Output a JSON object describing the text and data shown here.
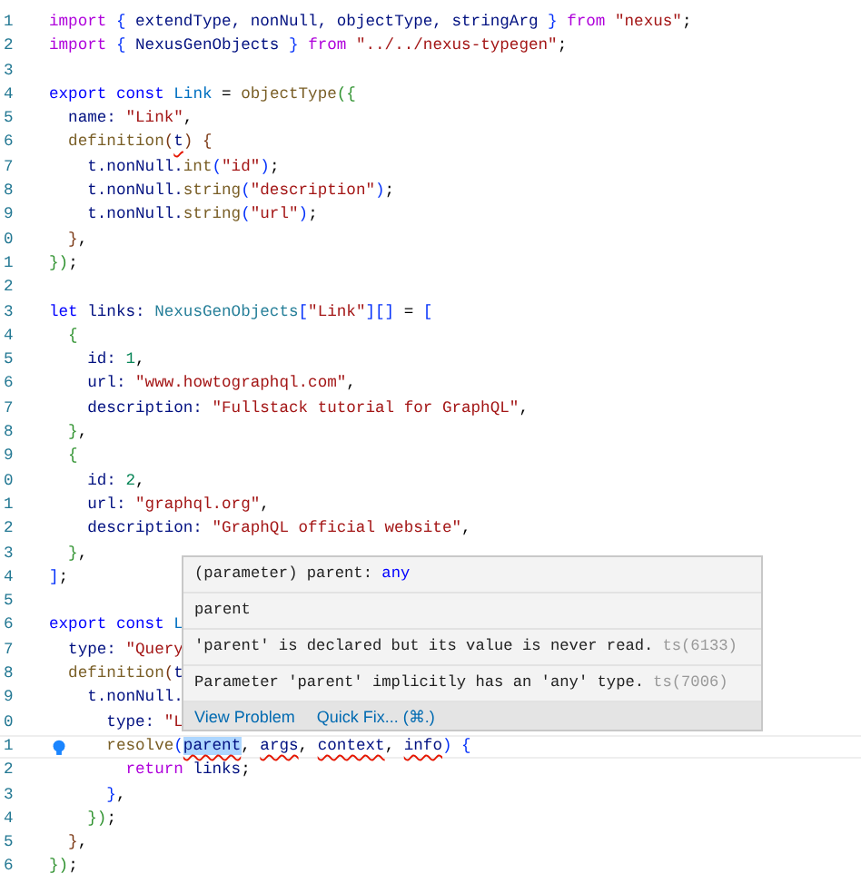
{
  "editor": {
    "lines": [
      {
        "number": "1",
        "current": false,
        "tokens": [
          {
            "text": "import",
            "kind": "control"
          },
          {
            "text": " { ",
            "kind": "b1"
          },
          {
            "text": "extendType, nonNull, objectType, stringArg",
            "kind": "var"
          },
          {
            "text": " } ",
            "kind": "b1"
          },
          {
            "text": "from",
            "kind": "control"
          },
          {
            "text": " \"nexus\"",
            "kind": "str"
          },
          {
            "text": ";",
            "kind": "plain"
          }
        ]
      },
      {
        "number": "2",
        "current": false,
        "tokens": [
          {
            "text": "import",
            "kind": "control"
          },
          {
            "text": " { ",
            "kind": "b1"
          },
          {
            "text": "NexusGenObjects",
            "kind": "var"
          },
          {
            "text": " } ",
            "kind": "b1"
          },
          {
            "text": "from",
            "kind": "control"
          },
          {
            "text": " \"../../nexus-typegen\"",
            "kind": "str"
          },
          {
            "text": ";",
            "kind": "plain"
          }
        ]
      },
      {
        "number": "3",
        "current": false
      },
      {
        "number": "4",
        "current": false,
        "tokens": [
          {
            "text": "export const",
            "kind": "storage"
          },
          {
            "text": " Link",
            "kind": "const"
          },
          {
            "text": " = ",
            "kind": "plain"
          },
          {
            "text": "objectType",
            "kind": "func"
          },
          {
            "text": "({",
            "kind": "b2"
          }
        ]
      },
      {
        "number": "5",
        "current": false,
        "tokens": [
          {
            "text": "  name: ",
            "kind": "var"
          },
          {
            "text": "\"Link\"",
            "kind": "str"
          },
          {
            "text": ",",
            "kind": "plain"
          }
        ]
      },
      {
        "number": "6",
        "current": false,
        "tokens": [
          {
            "text": "  definition",
            "kind": "func"
          },
          {
            "text": "(",
            "kind": "b3"
          },
          {
            "text": "t",
            "kind": "var-error"
          },
          {
            "text": ") {",
            "kind": "b3"
          }
        ]
      },
      {
        "number": "7",
        "current": false,
        "tokens": [
          {
            "text": "    t.nonNull.",
            "kind": "var"
          },
          {
            "text": "int",
            "kind": "func"
          },
          {
            "text": "(",
            "kind": "b1"
          },
          {
            "text": "\"id\"",
            "kind": "str"
          },
          {
            "text": ")",
            "kind": "b1"
          },
          {
            "text": ";",
            "kind": "plain"
          }
        ]
      },
      {
        "number": "8",
        "current": false,
        "tokens": [
          {
            "text": "    t.nonNull.",
            "kind": "var"
          },
          {
            "text": "string",
            "kind": "func"
          },
          {
            "text": "(",
            "kind": "b1"
          },
          {
            "text": "\"description\"",
            "kind": "str"
          },
          {
            "text": ")",
            "kind": "b1"
          },
          {
            "text": ";",
            "kind": "plain"
          }
        ]
      },
      {
        "number": "9",
        "current": false,
        "tokens": [
          {
            "text": "    t.nonNull.",
            "kind": "var"
          },
          {
            "text": "string",
            "kind": "func"
          },
          {
            "text": "(",
            "kind": "b1"
          },
          {
            "text": "\"url\"",
            "kind": "str"
          },
          {
            "text": ")",
            "kind": "b1"
          },
          {
            "text": ";",
            "kind": "plain"
          }
        ]
      },
      {
        "number": "0",
        "current": false,
        "tokens": [
          {
            "text": "  }",
            "kind": "b3"
          },
          {
            "text": ",",
            "kind": "plain"
          }
        ]
      },
      {
        "number": "1",
        "current": false,
        "tokens": [
          {
            "text": "})",
            "kind": "b2"
          },
          {
            "text": ";",
            "kind": "plain"
          }
        ]
      },
      {
        "number": "2",
        "current": false
      },
      {
        "number": "3",
        "current": false,
        "tokens": [
          {
            "text": "let",
            "kind": "storage"
          },
          {
            "text": " links: ",
            "kind": "var"
          },
          {
            "text": "NexusGenObjects",
            "kind": "type"
          },
          {
            "text": "[",
            "kind": "b1"
          },
          {
            "text": "\"Link\"",
            "kind": "str"
          },
          {
            "text": "][]",
            "kind": "b1"
          },
          {
            "text": " = ",
            "kind": "plain"
          },
          {
            "text": "[",
            "kind": "b1"
          }
        ]
      },
      {
        "number": "4",
        "current": false,
        "tokens": [
          {
            "text": "  {",
            "kind": "b2"
          }
        ]
      },
      {
        "number": "5",
        "current": false,
        "tokens": [
          {
            "text": "    id: ",
            "kind": "var"
          },
          {
            "text": "1",
            "kind": "num"
          },
          {
            "text": ",",
            "kind": "plain"
          }
        ]
      },
      {
        "number": "6",
        "current": false,
        "tokens": [
          {
            "text": "    url: ",
            "kind": "var"
          },
          {
            "text": "\"www.howtographql.com\"",
            "kind": "str"
          },
          {
            "text": ",",
            "kind": "plain"
          }
        ]
      },
      {
        "number": "7",
        "current": false,
        "tokens": [
          {
            "text": "    description: ",
            "kind": "var"
          },
          {
            "text": "\"Fullstack tutorial for GraphQL\"",
            "kind": "str"
          },
          {
            "text": ",",
            "kind": "plain"
          }
        ]
      },
      {
        "number": "8",
        "current": false,
        "tokens": [
          {
            "text": "  }",
            "kind": "b2"
          },
          {
            "text": ",",
            "kind": "plain"
          }
        ]
      },
      {
        "number": "9",
        "current": false,
        "tokens": [
          {
            "text": "  {",
            "kind": "b2"
          }
        ]
      },
      {
        "number": "0",
        "current": false,
        "tokens": [
          {
            "text": "    id: ",
            "kind": "var"
          },
          {
            "text": "2",
            "kind": "num"
          },
          {
            "text": ",",
            "kind": "plain"
          }
        ]
      },
      {
        "number": "1",
        "current": false,
        "tokens": [
          {
            "text": "    url: ",
            "kind": "var"
          },
          {
            "text": "\"graphql.org\"",
            "kind": "str"
          },
          {
            "text": ",",
            "kind": "plain"
          }
        ]
      },
      {
        "number": "2",
        "current": false,
        "tokens": [
          {
            "text": "    description: ",
            "kind": "var"
          },
          {
            "text": "\"GraphQL official website\"",
            "kind": "str"
          },
          {
            "text": ",",
            "kind": "plain"
          }
        ]
      },
      {
        "number": "3",
        "current": false,
        "tokens": [
          {
            "text": "  }",
            "kind": "b2"
          },
          {
            "text": ",",
            "kind": "plain"
          }
        ]
      },
      {
        "number": "4",
        "current": false,
        "tokens": [
          {
            "text": "]",
            "kind": "b1"
          },
          {
            "text": ";",
            "kind": "plain"
          }
        ]
      },
      {
        "number": "5",
        "current": false
      },
      {
        "number": "6",
        "current": false,
        "tokens": [
          {
            "text": "export const",
            "kind": "storage"
          },
          {
            "text": " L",
            "kind": "const"
          }
        ]
      },
      {
        "number": "7",
        "current": false,
        "tokens": [
          {
            "text": "  type: ",
            "kind": "var"
          },
          {
            "text": "\"Query",
            "kind": "str"
          }
        ]
      },
      {
        "number": "8",
        "current": false,
        "tokens": [
          {
            "text": "  definition",
            "kind": "func"
          },
          {
            "text": "(",
            "kind": "b3"
          },
          {
            "text": "t",
            "kind": "var"
          }
        ]
      },
      {
        "number": "9",
        "current": false,
        "tokens": [
          {
            "text": "    t.nonNull.",
            "kind": "var"
          }
        ]
      },
      {
        "number": "0",
        "current": false,
        "tokens": [
          {
            "text": "      type: ",
            "kind": "var"
          },
          {
            "text": "\"L",
            "kind": "str"
          }
        ]
      },
      {
        "number": "1",
        "current": true,
        "tokens": [
          {
            "text": "      resolve",
            "kind": "func"
          },
          {
            "text": "(",
            "kind": "b1"
          },
          {
            "text": "parent",
            "kind": "var-hover"
          },
          {
            "text": ", ",
            "kind": "plain"
          },
          {
            "text": "args",
            "kind": "var-error"
          },
          {
            "text": ", ",
            "kind": "plain"
          },
          {
            "text": "context",
            "kind": "var-error"
          },
          {
            "text": ", ",
            "kind": "plain"
          },
          {
            "text": "info",
            "kind": "var-error"
          },
          {
            "text": ")",
            "kind": "b1"
          },
          {
            "text": " {",
            "kind": "b1"
          }
        ]
      },
      {
        "number": "2",
        "current": false,
        "tokens": [
          {
            "text": "        return",
            "kind": "control"
          },
          {
            "text": " links",
            "kind": "var"
          },
          {
            "text": ";",
            "kind": "plain"
          }
        ]
      },
      {
        "number": "3",
        "current": false,
        "tokens": [
          {
            "text": "      }",
            "kind": "b1"
          },
          {
            "text": ",",
            "kind": "plain"
          }
        ]
      },
      {
        "number": "4",
        "current": false,
        "tokens": [
          {
            "text": "    })",
            "kind": "b2"
          },
          {
            "text": ";",
            "kind": "plain"
          }
        ]
      },
      {
        "number": "5",
        "current": false,
        "tokens": [
          {
            "text": "  }",
            "kind": "b3"
          },
          {
            "text": ",",
            "kind": "plain"
          }
        ]
      },
      {
        "number": "6",
        "current": false,
        "tokens": [
          {
            "text": "})",
            "kind": "b2"
          },
          {
            "text": ";",
            "kind": "plain"
          }
        ]
      }
    ]
  },
  "hover": {
    "signature_label": "(parameter) parent:",
    "signature_type": "any",
    "doc": "parent",
    "problems": [
      {
        "message": "'parent' is declared but its value is never read.",
        "code": "ts(6133)"
      },
      {
        "message": "Parameter 'parent' implicitly has an 'any' type.",
        "code": "ts(7006)"
      }
    ],
    "actions": [
      "View Problem",
      "Quick Fix... (⌘.)"
    ]
  }
}
